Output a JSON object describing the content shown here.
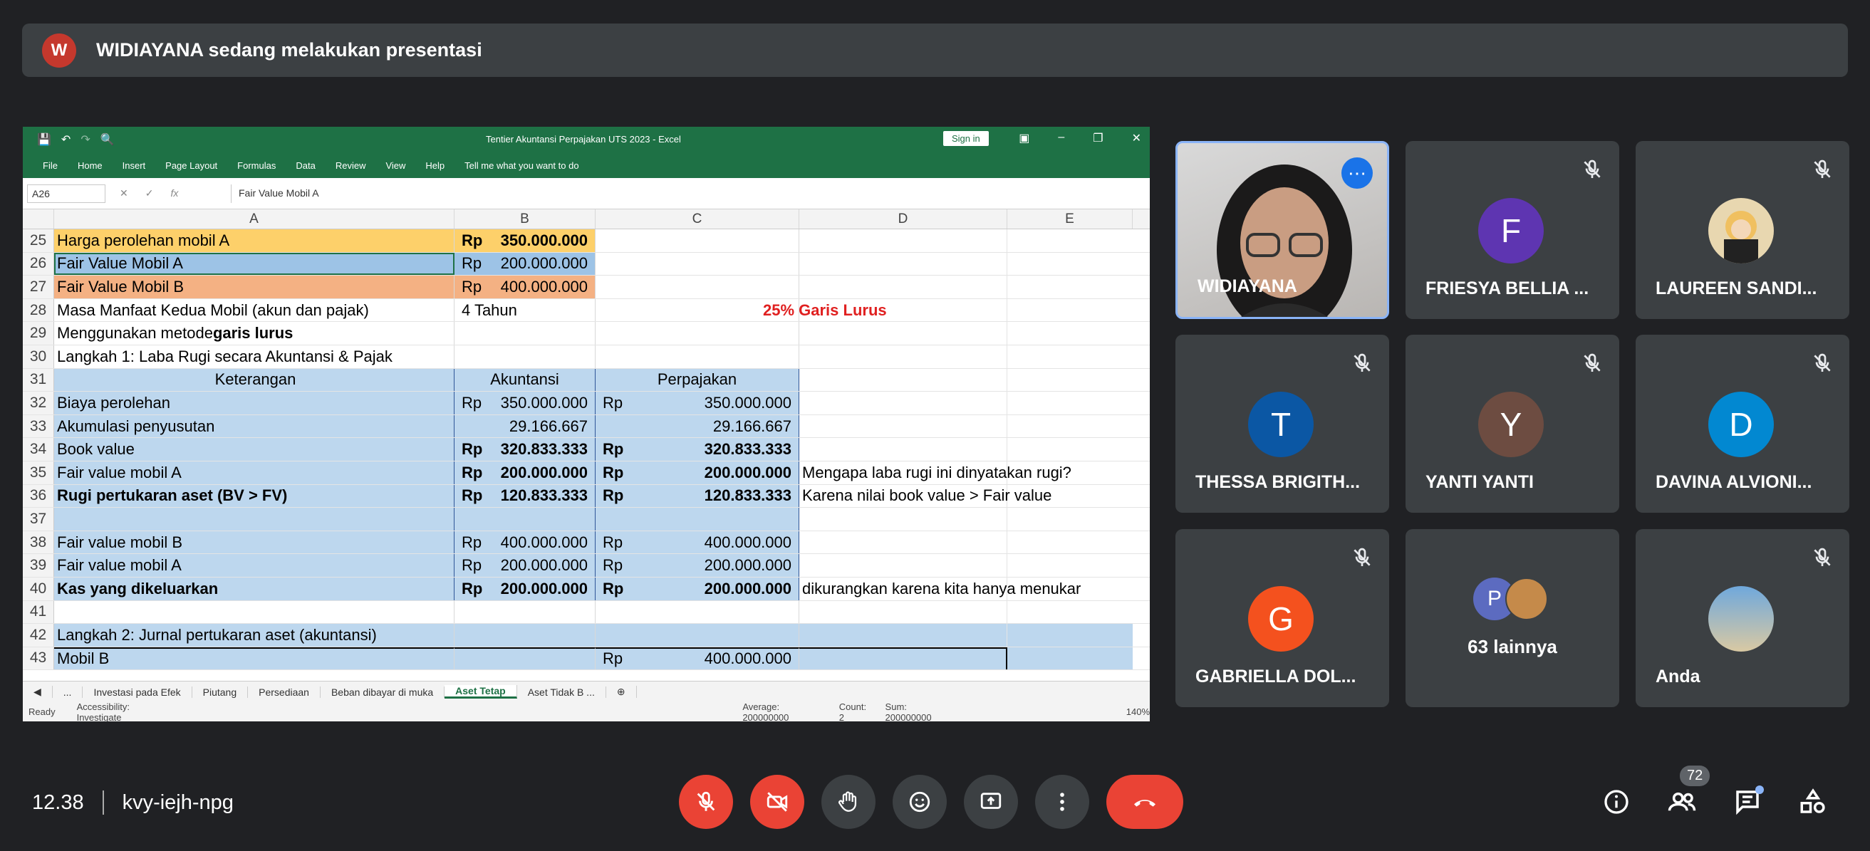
{
  "banner": {
    "avatar_letter": "W",
    "text": "WIDIAYANA sedang melakukan presentasi"
  },
  "excel": {
    "title": "Tentier Akuntansi Perpajakan UTS 2023 - Excel",
    "sign_in": "Sign in",
    "ribbon": [
      "File",
      "Home",
      "Insert",
      "Page Layout",
      "Formulas",
      "Data",
      "Review",
      "View",
      "Help",
      "Tell me what you want to do"
    ],
    "name_box": "A26",
    "formula": "Fair Value Mobil A",
    "columns": [
      "A",
      "B",
      "C",
      "D",
      "E"
    ],
    "rows": [
      {
        "n": "25",
        "a": "Harga perolehan mobil A",
        "b1": "Rp",
        "b2": "350.000.000"
      },
      {
        "n": "26",
        "a": "Fair Value Mobil A",
        "b1": "Rp",
        "b2": "200.000.000"
      },
      {
        "n": "27",
        "a": "Fair Value Mobil B",
        "b1": "Rp",
        "b2": "400.000.000"
      },
      {
        "n": "28",
        "a": "Masa Manfaat Kedua Mobil (akun dan pajak)",
        "b1": "4 Tahun",
        "d": "25% Garis Lurus"
      },
      {
        "n": "29",
        "a1": "Menggunakan metode ",
        "a2": "garis lurus"
      },
      {
        "n": "30",
        "a": "Langkah 1: Laba Rugi secara Akuntansi & Pajak"
      },
      {
        "n": "31",
        "a": "Keterangan",
        "b": "Akuntansi",
        "c": "Perpajakan"
      },
      {
        "n": "32",
        "a": "Biaya perolehan",
        "b1": "Rp",
        "b2": "350.000.000",
        "c1": "Rp",
        "c2": "350.000.000"
      },
      {
        "n": "33",
        "a": "Akumulasi penyusutan",
        "b2": "29.166.667",
        "c2": "29.166.667"
      },
      {
        "n": "34",
        "a": "Book value",
        "b1": "Rp",
        "b2": "320.833.333",
        "c1": "Rp",
        "c2": "320.833.333"
      },
      {
        "n": "35",
        "a": "Fair value mobil A",
        "b1": "Rp",
        "b2": "200.000.000",
        "c1": "Rp",
        "c2": "200.000.000",
        "d": "Mengapa laba rugi ini dinyatakan rugi?"
      },
      {
        "n": "36",
        "a": "Rugi pertukaran aset (BV > FV)",
        "b1": "Rp",
        "b2": "120.833.333",
        "c1": "Rp",
        "c2": "120.833.333",
        "d": "Karena nilai book value > Fair value"
      },
      {
        "n": "37"
      },
      {
        "n": "38",
        "a": "Fair value mobil B",
        "b1": "Rp",
        "b2": "400.000.000",
        "c1": "Rp",
        "c2": "400.000.000"
      },
      {
        "n": "39",
        "a": "Fair value mobil A",
        "b1": "Rp",
        "b2": "200.000.000",
        "c1": "Rp",
        "c2": "200.000.000"
      },
      {
        "n": "40",
        "a": "Kas yang dikeluarkan",
        "b1": "Rp",
        "b2": "200.000.000",
        "c1": "Rp",
        "c2": "200.000.000",
        "d": "dikurangkan karena kita hanya menukar"
      },
      {
        "n": "41"
      },
      {
        "n": "42",
        "a": "Langkah 2: Jurnal pertukaran aset (akuntansi)"
      },
      {
        "n": "43",
        "a": "Mobil B",
        "c1": "Rp",
        "c2": "400.000.000"
      }
    ],
    "sheet_tabs": [
      "...",
      "Investasi pada Efek",
      "Piutang",
      "Persediaan",
      "Beban dibayar di muka",
      "Aset Tetap",
      "Aset Tidak B ..."
    ],
    "active_tab": "Aset Tetap",
    "status": {
      "ready": "Ready",
      "accessibility": "Accessibility: Investigate",
      "average": "Average: 200000000",
      "count": "Count: 2",
      "sum": "Sum: 200000000",
      "zoom": "140%"
    }
  },
  "tiles": [
    {
      "name": "WIDIAYANA",
      "type": "camera"
    },
    {
      "name": "FRIESYA BELLIA ...",
      "letter": "F",
      "color": "#5e35b1"
    },
    {
      "name": "LAUREEN SANDI...",
      "letter": "",
      "color": "#6d5a3a"
    },
    {
      "name": "THESSA BRIGITH...",
      "letter": "T",
      "color": "#0b57a4"
    },
    {
      "name": "YANTI YANTI",
      "letter": "Y",
      "color": "#6d4c41"
    },
    {
      "name": "DAVINA ALVIONI...",
      "letter": "D",
      "color": "#0288d1"
    },
    {
      "name": "GABRIELLA DOL...",
      "letter": "G",
      "color": "#f4511e"
    },
    {
      "name": "63 lainnya",
      "letter": "P",
      "color": "#5c6bc0"
    },
    {
      "name": "Anda",
      "letter": "",
      "color": "#4a7ab0"
    }
  ],
  "bottom": {
    "time": "12.38",
    "code": "kvy-iejh-npg",
    "participants_count": "72"
  },
  "colors": {
    "bg": "#202124",
    "tile": "#3c4043",
    "red": "#ea4335",
    "excel_green": "#1e7145"
  }
}
